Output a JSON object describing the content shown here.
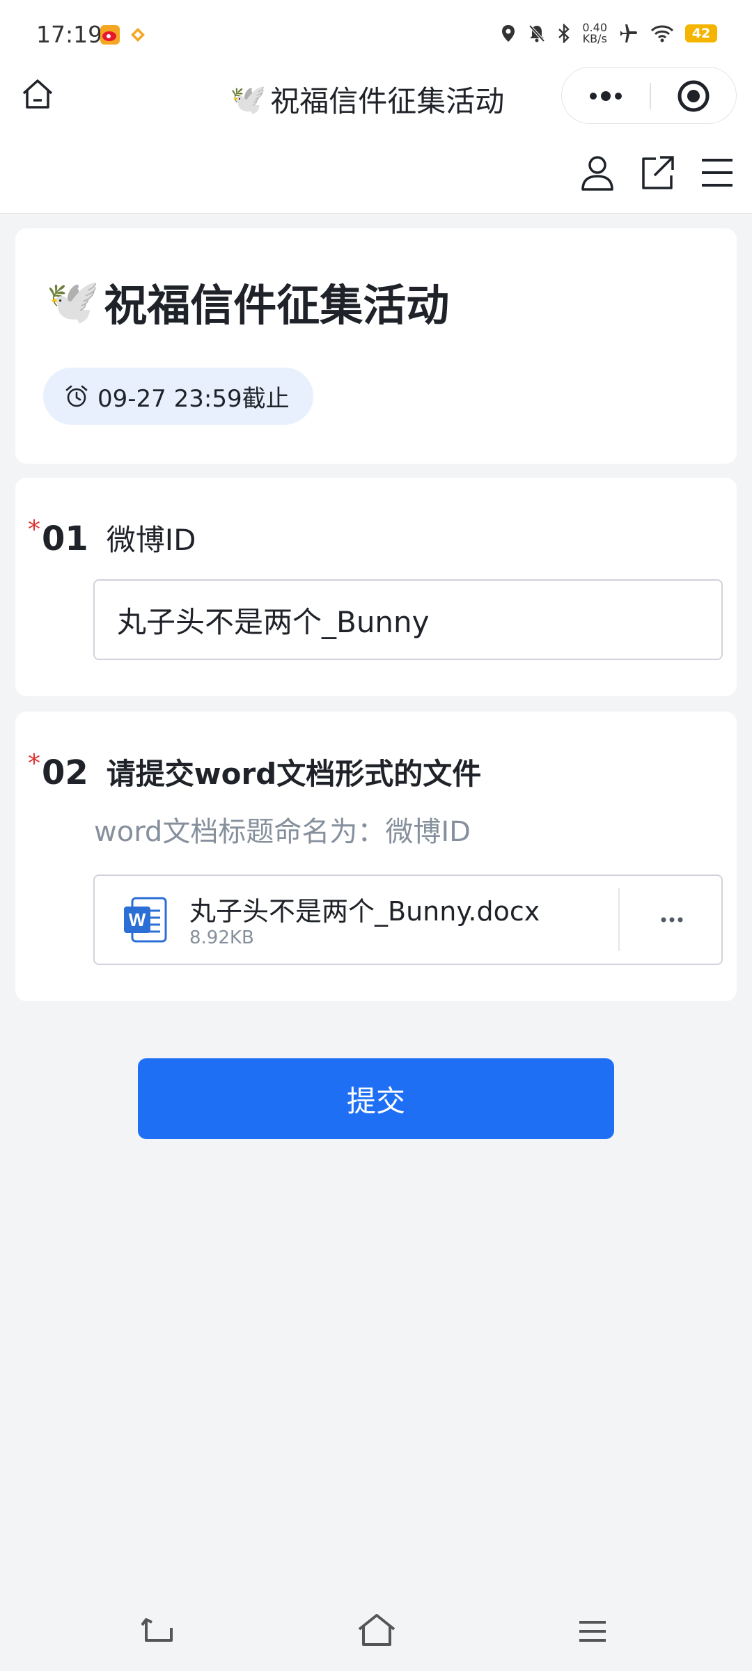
{
  "status_bar": {
    "time": "17:19",
    "net_speed_value": "0.40",
    "net_speed_unit": "KB/s",
    "battery": "42",
    "icons": [
      "weibo-app-icon",
      "app-icon",
      "location-icon",
      "mute-bell-icon",
      "bluetooth-icon",
      "airplane-icon",
      "wifi-icon",
      "battery-icon"
    ]
  },
  "header": {
    "emoji": "🕊️",
    "title": "祝福信件征集活动",
    "icons": [
      "home-icon",
      "more-dots-icon",
      "close-target-icon",
      "user-icon",
      "share-icon",
      "menu-icon"
    ]
  },
  "form": {
    "emoji": "🕊️",
    "title": "祝福信件征集活动",
    "deadline": "09-27 23:59截止"
  },
  "questions": [
    {
      "required_mark": "*",
      "number": "01",
      "label": "微博ID",
      "value": "丸子头不是两个_Bunny"
    },
    {
      "required_mark": "*",
      "number": "02",
      "label": "请提交word文档形式的文件",
      "description": "word文档标题命名为：微博ID",
      "file": {
        "icon_letter": "W",
        "name": "丸子头不是两个_Bunny.docx",
        "size": "8.92KB"
      }
    }
  ],
  "submit_label": "提交",
  "colors": {
    "accent": "#1f6ff5",
    "required": "#e03131",
    "chip_bg": "#e8f0fe",
    "page_bg": "#f3f4f6"
  }
}
